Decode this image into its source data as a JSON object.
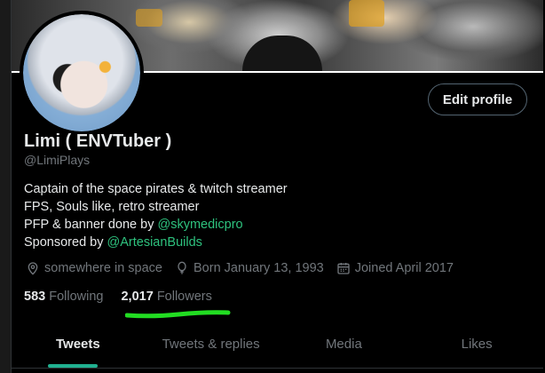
{
  "profile": {
    "name": "Limi ( ENVTuber )",
    "handle": "@LimiPlays",
    "edit_button": "Edit profile",
    "bio": {
      "line1": "Captain of the space pirates & twitch streamer",
      "line2": "FPS, Souls like, retro streamer",
      "line3_prefix": "PFP & banner done by ",
      "line3_link": "@skymedicpro",
      "line4_prefix": "Sponsored by ",
      "line4_link": "@ArtesianBuilds"
    },
    "meta": {
      "location": "somewhere in space",
      "birthday": "Born January 13, 1993",
      "joined": "Joined April 2017"
    },
    "following_count": "583",
    "following_label": "Following",
    "followers_count": "2,017",
    "followers_label": "Followers"
  },
  "tabs": [
    {
      "label": "Tweets"
    },
    {
      "label": "Tweets & replies"
    },
    {
      "label": "Media"
    },
    {
      "label": "Likes"
    }
  ],
  "colors": {
    "link": "#2ec27e",
    "underline_mark": "#22dd22",
    "tab_indicator": "#20b090"
  }
}
